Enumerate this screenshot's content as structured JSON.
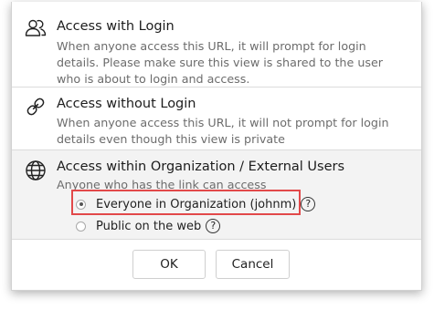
{
  "options": [
    {
      "icon": "users-icon",
      "title": "Access with Login",
      "description": "When anyone access this URL, it will prompt for login details. Please make sure this view is shared to the user who is about to login and access."
    },
    {
      "icon": "link-icon",
      "title": "Access without Login",
      "description": "When anyone access this URL, it will not prompt for login details even though this view is private"
    },
    {
      "icon": "globe-icon",
      "title": "Access within Organization / External Users",
      "description": "Anyone who has the link can access",
      "selected": true,
      "sub_options": [
        {
          "label": "Everyone in Organization (johnm)",
          "checked": true,
          "help": "?"
        },
        {
          "label": "Public on the web",
          "checked": false,
          "help": "?"
        }
      ]
    }
  ],
  "buttons": {
    "ok": "OK",
    "cancel": "Cancel"
  },
  "colors": {
    "highlight_border": "#e2494a",
    "selected_bg": "#f3f3f3"
  }
}
